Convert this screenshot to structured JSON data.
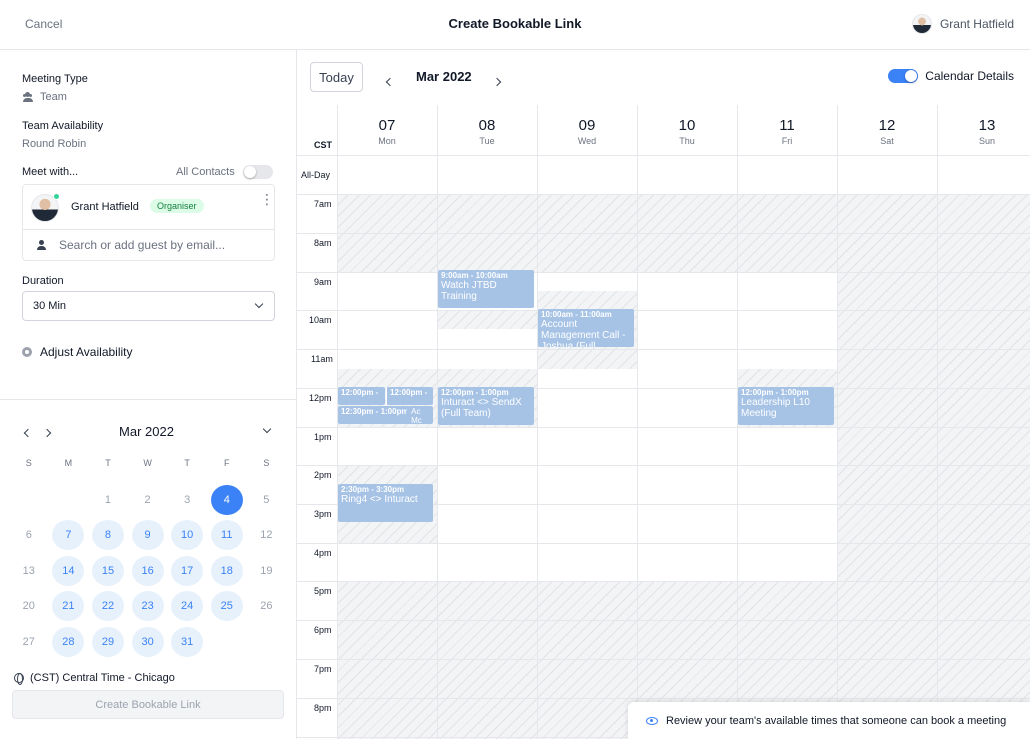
{
  "topbar": {
    "cancel": "Cancel",
    "title": "Create Bookable Link",
    "user_name": "Grant Hatfield"
  },
  "left": {
    "meeting_type_label": "Meeting Type",
    "meeting_type_value": "Team",
    "team_availability_label": "Team Availability",
    "team_availability_value": "Round Robin",
    "meet_with_label": "Meet with...",
    "all_contacts_label": "All Contacts",
    "guest_name": "Grant Hatfield",
    "guest_badge": "Organiser",
    "search_placeholder": "Search or add guest by email...",
    "duration_label": "Duration",
    "duration_value": "30 Min",
    "adjust_label": "Adjust Availability",
    "mini_month": "Mar 2022",
    "dow": [
      "S",
      "M",
      "T",
      "W",
      "T",
      "F",
      "S"
    ],
    "timezone": "(CST) Central Time - Chicago",
    "create_button": "Create Bookable Link"
  },
  "calendar": {
    "today": "Today",
    "month": "Mar 2022",
    "details_label": "Calendar Details",
    "tz": "CST",
    "allday": "All-Day",
    "days": [
      {
        "num": "07",
        "dow": "Mon"
      },
      {
        "num": "08",
        "dow": "Tue"
      },
      {
        "num": "09",
        "dow": "Wed"
      },
      {
        "num": "10",
        "dow": "Thu"
      },
      {
        "num": "11",
        "dow": "Fri"
      },
      {
        "num": "12",
        "dow": "Sat"
      },
      {
        "num": "13",
        "dow": "Sun"
      }
    ],
    "hours": [
      "7am",
      "8am",
      "9am",
      "10am",
      "11am",
      "12pm",
      "1pm",
      "2pm",
      "3pm",
      "4pm",
      "5pm",
      "6pm",
      "7pm",
      "8pm"
    ],
    "events": [
      {
        "time": "9:00am - 10:00am",
        "title": "Watch JTBD Training"
      },
      {
        "time": "10:00am - 11:00am",
        "title": "Account Management Call - Joshua (Full"
      },
      {
        "time": "12:00pm -",
        "title": ""
      },
      {
        "time": "12:00pm -",
        "title": ""
      },
      {
        "time": "12:30pm - 1:00pm",
        "title": "Ac Mc"
      },
      {
        "time": "12:00pm - 1:00pm",
        "title": "Inturact <> SendX (Full Team)"
      },
      {
        "time": "12:00pm - 1:00pm",
        "title": "Leadership L10 Meeting"
      },
      {
        "time": "2:30pm - 3:30pm",
        "title": "Ring4 <> Inturact"
      }
    ]
  },
  "tip": "Review your team's available times that someone can book a meeting",
  "colors": {
    "accent": "#3b82f6",
    "event": "#a6c3e6",
    "available_day": "#e7f1fb"
  }
}
